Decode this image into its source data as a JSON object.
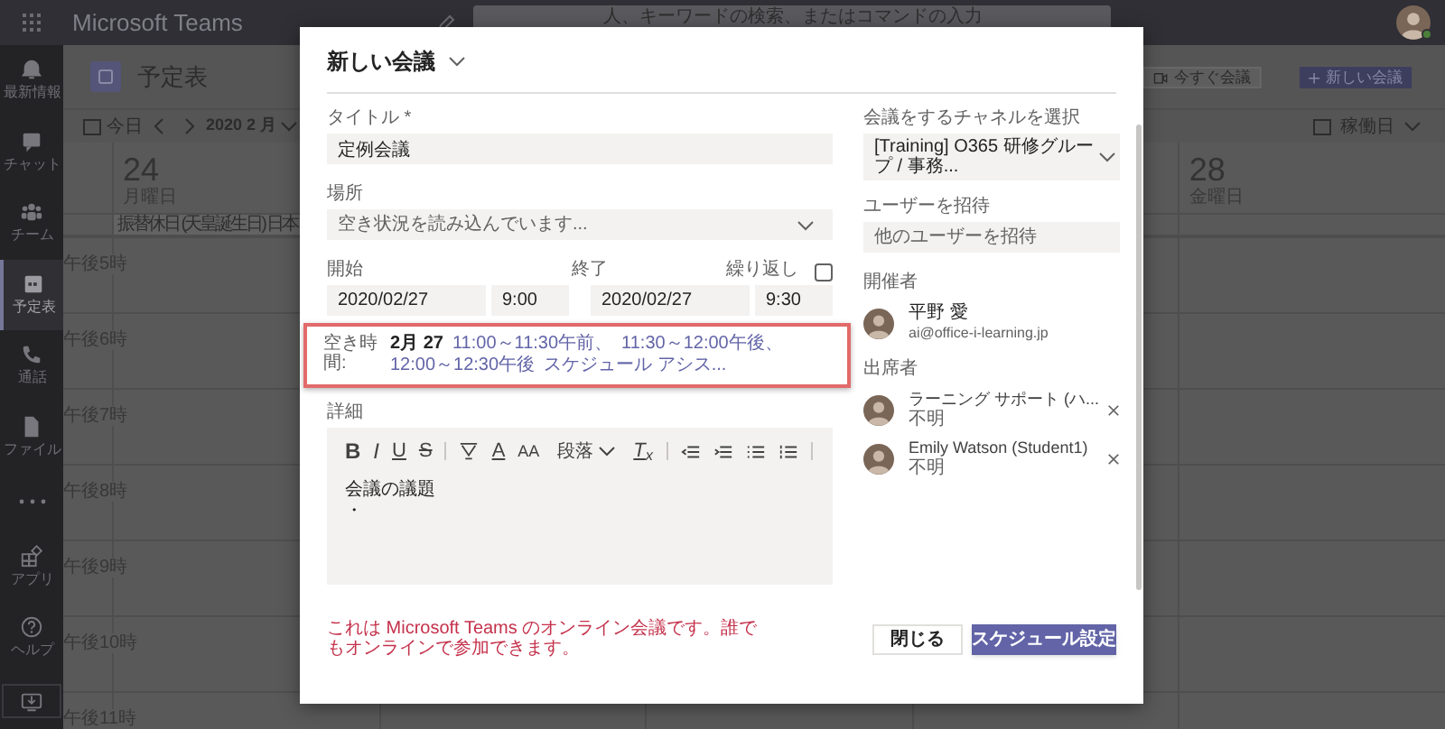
{
  "app": {
    "title": "Microsoft Teams",
    "search_placeholder": "人、キーワードの検索、またはコマンドの入力"
  },
  "rail": [
    {
      "kind": "bell",
      "label": "最新情報",
      "selected": false
    },
    {
      "kind": "chat",
      "label": "チャット",
      "selected": false
    },
    {
      "kind": "team",
      "label": "チーム",
      "selected": false
    },
    {
      "kind": "calendar",
      "label": "予定表",
      "selected": true
    },
    {
      "kind": "call",
      "label": "通話",
      "selected": false
    },
    {
      "kind": "file",
      "label": "ファイル",
      "selected": false
    },
    {
      "kind": "more"
    }
  ],
  "rail_bottom": [
    {
      "kind": "apps",
      "label": "アプリ"
    },
    {
      "kind": "help",
      "label": "ヘルプ"
    },
    {
      "kind": "download"
    }
  ],
  "calendar": {
    "title": "予定表",
    "today": "今日",
    "month": "2020 2 月",
    "view": "稼働日",
    "actions": [
      {
        "kind": "meet-now",
        "label": "今すぐ会議"
      },
      {
        "kind": "new",
        "label": "新しい会議"
      }
    ],
    "days": [
      {
        "date": "24",
        "weekday": "月曜日",
        "event": "振替休日 (天皇誕生日) 日本"
      },
      {
        "date": "28",
        "weekday": "金曜日"
      }
    ],
    "times": [
      "午後5時",
      "午後6時",
      "午後7時",
      "午後8時",
      "午後9時",
      "午後10時",
      "午後11時"
    ]
  },
  "dialog": {
    "title": "新しい会議",
    "title_field": {
      "label": "タイトル *",
      "value": "定例会議"
    },
    "location": {
      "label": "場所",
      "placeholder": "空き状況を読み込んでいます..."
    },
    "start": {
      "label": "開始",
      "date": "2020/02/27",
      "time": "9:00"
    },
    "end": {
      "label": "終了",
      "date": "2020/02/27",
      "time": "9:30"
    },
    "repeat": {
      "label": "繰り返し",
      "checked": false
    },
    "availability": {
      "label": "空き時間:",
      "date": "2月 27",
      "slots": [
        "11:00～11:30午前、",
        "11:30～12:00午後、",
        "12:00～12:30午後"
      ],
      "assistant": "スケジュール アシス..."
    },
    "details": {
      "label": "詳細",
      "body": [
        "会議の議題",
        "・"
      ],
      "toolbar": [
        {
          "kind": "bold",
          "label": "B"
        },
        {
          "kind": "italic",
          "label": "I"
        },
        {
          "kind": "underline",
          "label": "U"
        },
        {
          "kind": "strike",
          "label": "S"
        },
        {
          "kind": "divider"
        },
        {
          "kind": "highlight"
        },
        {
          "kind": "font-color",
          "label": "A"
        },
        {
          "kind": "font-size",
          "label": "AA"
        },
        {
          "kind": "paragraph",
          "label": "段落"
        },
        {
          "kind": "clear",
          "label": "T$_{x}$"
        },
        {
          "kind": "divider"
        },
        {
          "kind": "outdent"
        },
        {
          "kind": "indent"
        },
        {
          "kind": "bullets"
        },
        {
          "kind": "numbering"
        },
        {
          "kind": "divider"
        }
      ]
    },
    "channel": {
      "label": "会議をするチャネルを選択",
      "value": "[Training] O365 研修グループ / 事務..."
    },
    "invite": {
      "label": "ユーザーを招待",
      "placeholder": "他のユーザーを招待"
    },
    "organizer": {
      "label": "開催者",
      "name": "平野 愛",
      "email": "ai@office-i-learning.jp"
    },
    "attendees": {
      "label": "出席者",
      "items": [
        {
          "name": "ラーニング サポート (ハ...",
          "status": "不明"
        },
        {
          "name": "Emily Watson (Student1)",
          "status": "不明"
        }
      ]
    },
    "note": "これは Microsoft Teams のオンライン会議です。誰でもオンラインで参加できます。",
    "buttons": [
      {
        "kind": "secondary",
        "label": "閉じる"
      },
      {
        "kind": "primary",
        "label": "スケジュール設定"
      }
    ]
  }
}
